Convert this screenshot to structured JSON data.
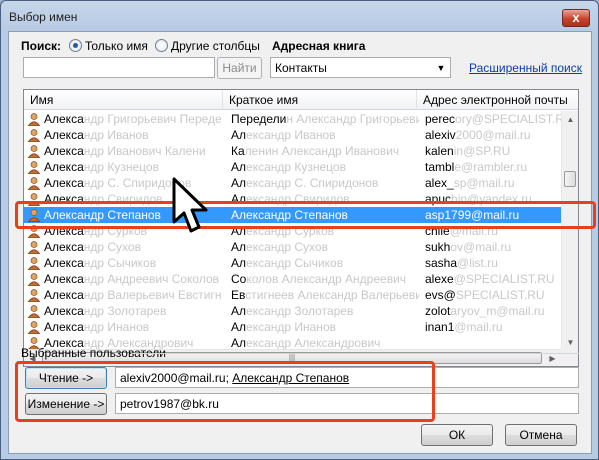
{
  "window": {
    "title": "Выбор имен",
    "close_label": "x"
  },
  "search": {
    "label": "Поиск:",
    "option_name_only": "Только имя",
    "option_other_columns": "Другие столбцы",
    "address_book_label": "Адресная книга",
    "input_value": "",
    "find_button": "Найти",
    "address_book_value": "Контакты",
    "advanced_search_link": "Расширенный поиск"
  },
  "grid": {
    "columns": [
      "Имя",
      "Краткое имя",
      "Адрес электронной почты"
    ],
    "rows": [
      {
        "name": "Алекса",
        "name_ghost": "ндр Григорьевич Переде",
        "short": "Передели",
        "short_ghost": "н Александр Григорьевич",
        "email": "perec",
        "email_ghost": "ory@SPECIALIST.RU",
        "selected": false
      },
      {
        "name": "Алекса",
        "name_ghost": "ндр Иванов",
        "short": "Ал",
        "short_ghost": "ександр Иванов",
        "email": "alexiv",
        "email_ghost": "2000@mail.ru",
        "selected": false
      },
      {
        "name": "Алекса",
        "name_ghost": "ндр Иванович Калени",
        "short": "Ка",
        "short_ghost": "ленин Александр Иванович",
        "email": "kalen",
        "email_ghost": "in@SP.RU",
        "selected": false
      },
      {
        "name": "Алекса",
        "name_ghost": "ндр Кузнецов",
        "short": "Ал",
        "short_ghost": "ександр Кузнецов",
        "email": "tambl",
        "email_ghost": "e@rambler.ru",
        "selected": false
      },
      {
        "name": "Алекса",
        "name_ghost": "ндр С. Спиридонов",
        "short": "Ал",
        "short_ghost": "ександр С. Спиридонов",
        "email": "alex_",
        "email_ghost": "sp@mail.ru",
        "selected": false
      },
      {
        "name": "Алекса",
        "name_ghost": "ндр Свиридов",
        "short": "Ал",
        "short_ghost": "ександр Свиридов",
        "email": "apuc",
        "email_ghost": "hin@yandex.ru",
        "selected": false
      },
      {
        "name": "Александр Степанов",
        "name_ghost": "",
        "short": "Александр Степанов",
        "short_ghost": "",
        "email": "asp1799@mail.ru",
        "email_ghost": "",
        "selected": true
      },
      {
        "name": "Алекса",
        "name_ghost": "ндр Сурков",
        "short": "Ал",
        "short_ghost": "ександр Сурков",
        "email": "chile",
        "email_ghost": "@mail.ru",
        "selected": false
      },
      {
        "name": "Алекса",
        "name_ghost": "ндр Сухов",
        "short": "Ал",
        "short_ghost": "ександр Сухов",
        "email": "sukh",
        "email_ghost": "ov@mail.ru",
        "selected": false
      },
      {
        "name": "Алекса",
        "name_ghost": "ндр Сычиков",
        "short": "Ал",
        "short_ghost": "ександр Сычиков",
        "email": "sasha",
        "email_ghost": "@list.ru",
        "selected": false
      },
      {
        "name": "Алекса",
        "name_ghost": "ндр Андреевич Соколов",
        "short": "Со",
        "short_ghost": "колов Александр Андреевич",
        "email": "alexe",
        "email_ghost": "@SPECIALIST.RU",
        "selected": false
      },
      {
        "name": "Алекса",
        "name_ghost": "ндр Валерьевич Евстигн",
        "short": "Ев",
        "short_ghost": "стигнеев Александр Валерьевич",
        "email": "evs@",
        "email_ghost": "SPECIALIST.RU",
        "selected": false
      },
      {
        "name": "Алекса",
        "name_ghost": "ндр Золотарев",
        "short": "Ал",
        "short_ghost": "ександр Золотарев",
        "email": "zolot",
        "email_ghost": "aryov_m@mail.ru",
        "selected": false
      },
      {
        "name": "Алекса",
        "name_ghost": "ндр Инанов",
        "short": "Ал",
        "short_ghost": "ександр Инанов",
        "email": "inan1",
        "email_ghost": "@mail.ru",
        "selected": false
      },
      {
        "name": "Алекса",
        "name_ghost": "ндр Александрович",
        "short": "Ал",
        "short_ghost": "ександр Александрович",
        "email": "",
        "email_ghost": "",
        "selected": false
      }
    ]
  },
  "recipients": {
    "section_label": "Выбранные пользователи",
    "read_button": "Чтение ->",
    "read_value_plain": "alexiv2000@mail.ru; ",
    "read_value_underlined": "Александр Степанов",
    "edit_button": "Изменение ->",
    "edit_value": "petrov1987@bk.ru"
  },
  "footer": {
    "ok_button": "ОК",
    "cancel_button": "Отмена"
  },
  "colors": {
    "selection": "#3399ff",
    "highlight_box": "#e8401c",
    "link": "#0a3ea8"
  }
}
